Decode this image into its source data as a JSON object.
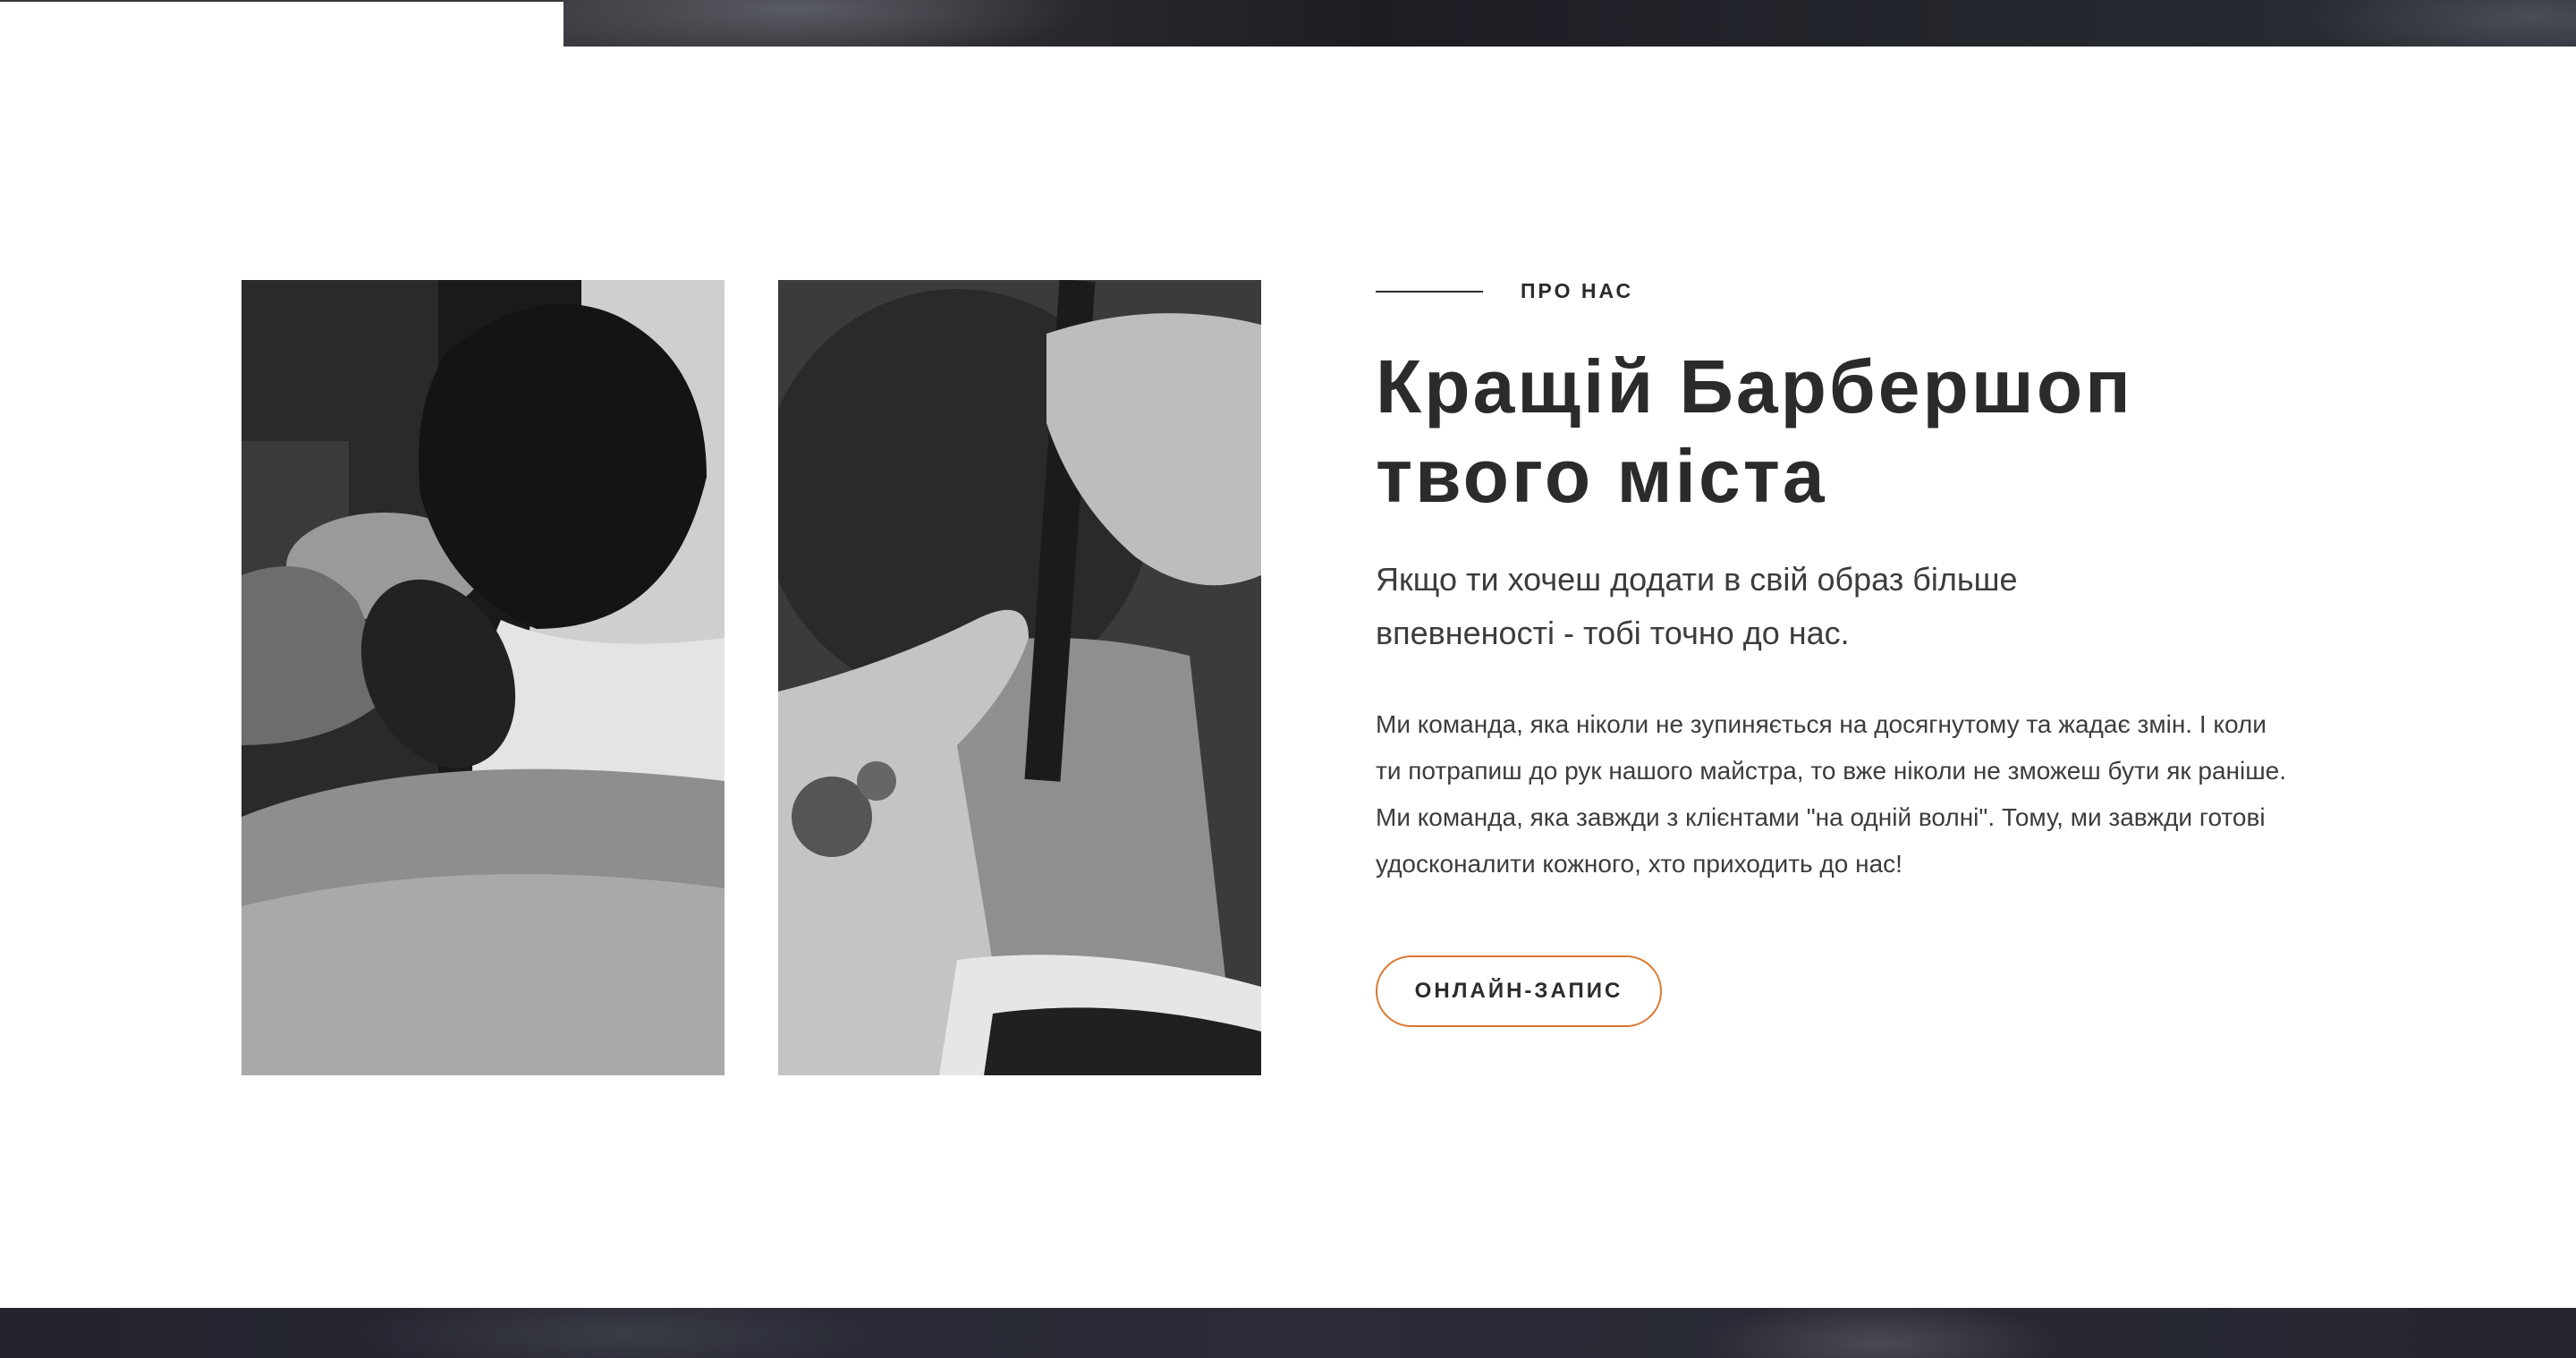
{
  "about": {
    "eyebrow": "ПРО НАС",
    "headline_line1": "Кращій Барбершоп",
    "headline_line2": "твого міста",
    "lead": "Якщо ти хочеш додати в свій образ більше впевненості - тобі точно до нас.",
    "body": "Ми команда, яка ніколи не зупиняється на досягнутому та жадає змін. І коли ти потрапиш до рук нашого майстра, то вже ніколи не зможеш бути як раніше. Ми команда, яка завжди з клієнтами \"на одній волні\". Тому, ми завжди готові удосконалити кожного, хто приходить до нас!",
    "cta_label": "ОНЛАЙН-ЗАПИС"
  },
  "colors": {
    "accent": "#d9772f",
    "text": "#2b2b2b",
    "dark_band": "#23242e"
  }
}
